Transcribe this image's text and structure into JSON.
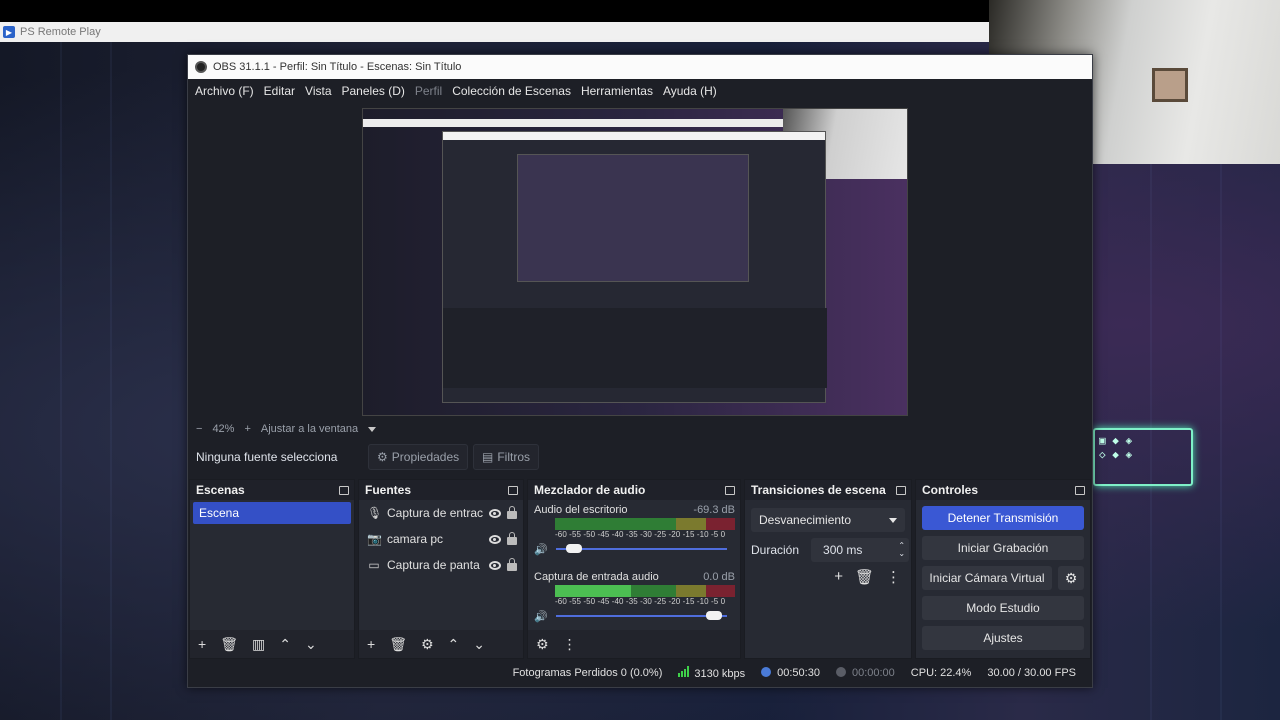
{
  "ps_remote": {
    "title": "PS Remote Play"
  },
  "window": {
    "title": "OBS 31.1.1 - Perfil: Sin Título - Escenas: Sin Título"
  },
  "menu": [
    "Archivo (F)",
    "Editar",
    "Vista",
    "Paneles (D)",
    "Perfil",
    "Colección de Escenas",
    "Herramientas",
    "Ayuda (H)"
  ],
  "zoom": {
    "minus": "−",
    "value": "42%",
    "plus": "+",
    "fit": "Ajustar a la ventana"
  },
  "source_bar": {
    "none_selected": "Ninguna fuente selecciona",
    "properties": "Propiedades",
    "filters": "Filtros"
  },
  "docks": {
    "scenes": {
      "title": "Escenas",
      "items": [
        "Escena"
      ]
    },
    "sources": {
      "title": "Fuentes",
      "items": [
        "Captura de entrac",
        "camara pc",
        "Captura de panta"
      ]
    },
    "mixer": {
      "title": "Mezclador de audio",
      "scale": "-60 -55 -50 -45 -40 -35 -30 -25 -20 -15 -10 -5 0",
      "channels": [
        {
          "name": "Audio del escritorio",
          "db": "-69.3 dB",
          "level": 0.0,
          "volume": 0.15
        },
        {
          "name": "Captura de entrada audio",
          "db": "0.0 dB",
          "level": 0.42,
          "volume": 0.97
        }
      ]
    },
    "transitions": {
      "title": "Transiciones de escena",
      "selected": "Desvanecimiento",
      "duration_label": "Duración",
      "duration_value": "300 ms"
    },
    "controls": {
      "title": "Controles",
      "stop_stream": "Detener Transmisión",
      "start_recording": "Iniciar Grabación",
      "start_virtualcam": "Iniciar Cámara Virtual",
      "studio_mode": "Modo Estudio",
      "settings": "Ajustes"
    }
  },
  "status": {
    "dropped": "Fotogramas Perdidos 0 (0.0%)",
    "bitrate": "3130 kbps",
    "stream_time": "00:50:30",
    "rec_time": "00:00:00",
    "cpu": "CPU: 22.4%",
    "fps": "30.00 / 30.00 FPS"
  },
  "colors": {
    "accent": "#3a58d4",
    "meter_green": "#4ec254",
    "bitrate_green": "#3fd04a",
    "stream_indicator": "#4a7bd8"
  }
}
